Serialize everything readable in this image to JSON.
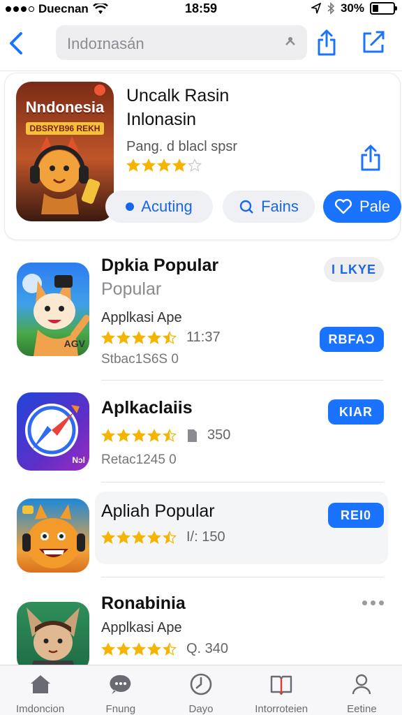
{
  "status": {
    "carrier": "Duecnan",
    "time": "18:59",
    "battery": "30%",
    "battery_level": 0.3
  },
  "nav": {
    "search_text": "Indoɪnasán"
  },
  "featured": {
    "icon_title": "Nndonesia",
    "icon_subtitle": "DBSRYB96 REKH",
    "title_line1": "Uncalk Rasin",
    "title_line2": "Inlonasin",
    "subtitle": "Pang. d blacl spsr",
    "rating": 4,
    "chips": {
      "accounting": "Acuting",
      "fans": "Fains",
      "fave": "Pale"
    }
  },
  "apps": [
    {
      "name": "Dpkia Popular",
      "subname": "Popular",
      "category": "Applkasi Ape",
      "rating": 4.5,
      "meta": "11:37",
      "sub2": "Stbac1S6S 0",
      "button": "I LKYE",
      "icon_badge": "AGV"
    },
    {
      "name": "Aplkaclaiis",
      "rating": 4.5,
      "meta": "350",
      "sub2": "Retac1245 0",
      "button": "KIAR",
      "icon_badge": "Nɔl"
    },
    {
      "name": "Apliah Popular",
      "rating": 4.5,
      "meta": "I/: 150",
      "button": "REI0"
    },
    {
      "name": "Ronabinia",
      "category": "Applkasi Ape",
      "rating": 4.5,
      "meta": "Q. 340"
    }
  ],
  "tabs": [
    {
      "label": "Imdoncion",
      "icon": "home-icon"
    },
    {
      "label": "Fnung",
      "icon": "chat-icon"
    },
    {
      "label": "Dayo",
      "icon": "clock-icon"
    },
    {
      "label": "Intorroteien",
      "icon": "book-icon"
    },
    {
      "label": "Eetine",
      "icon": "person-icon"
    }
  ],
  "colors": {
    "accent": "#1a73ff",
    "star": "#f4b400",
    "tab_active": "#6a6a72"
  }
}
